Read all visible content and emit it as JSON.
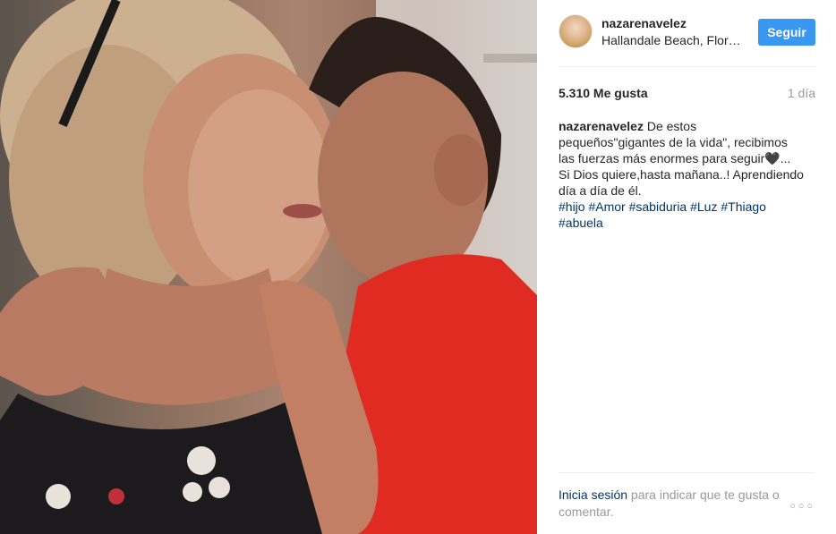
{
  "post": {
    "username": "nazarenavelez",
    "location": "Hallandale Beach, Florida",
    "follow_label": "Seguir",
    "likes": "5.310 Me gusta",
    "time_ago": "1 día",
    "caption": {
      "username": "nazarenavelez",
      "text": "De estos pequeños\"gigantes de la vida\", recibimos las fuerzas más enormes para seguir🖤... Si Dios quiere,hasta mañana..! Aprendiendo día a día de él.",
      "tags": [
        "#hijo",
        "#Amor",
        "#sabiduria",
        "#Luz",
        "#Thiago",
        "#abuela"
      ]
    },
    "footer": {
      "login_label": "Inicia sesión",
      "rest": " para indicar que te gusta o comentar.",
      "more_icon": "ellipsis-icon",
      "more_symbol": "○○○"
    }
  },
  "colors": {
    "accent": "#3897f0",
    "link": "#003569",
    "muted": "#999999",
    "text": "#262626"
  }
}
